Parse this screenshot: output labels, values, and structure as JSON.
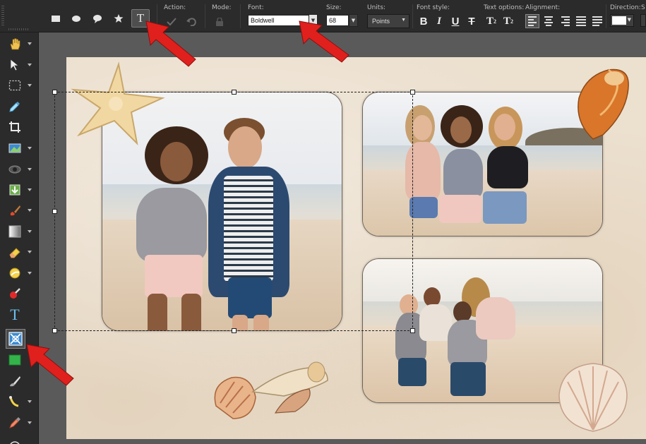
{
  "options_bar": {
    "labels": {
      "action": "Action:",
      "mode": "Mode:",
      "font": "Font:",
      "size": "Size:",
      "units": "Units:",
      "font_style": "Font style:",
      "text_options": "Text options:",
      "alignment": "Alignment:",
      "direction": "Direction:",
      "direction_cut": "S"
    },
    "shape_tools": [
      "rectangle-icon",
      "ellipse-icon",
      "speech-bubble-icon",
      "star-icon",
      "text-shape-icon"
    ],
    "selected_shape_tool": "text-shape-icon",
    "text_tool_glyph": "T",
    "font_value": "Boldwell",
    "size_value": "68",
    "units_value": "Points",
    "font_style_buttons": [
      {
        "name": "bold",
        "glyph": "B"
      },
      {
        "name": "italic",
        "glyph": "I"
      },
      {
        "name": "underline",
        "glyph": "U"
      },
      {
        "name": "strikethrough",
        "glyph": "T"
      }
    ],
    "text_options_buttons": [
      {
        "name": "superscript",
        "glyph": "T",
        "sub": "2"
      },
      {
        "name": "subscript",
        "glyph": "T",
        "sub": "2"
      }
    ],
    "alignment_buttons": [
      "align-left-icon",
      "align-center-icon",
      "align-right-icon",
      "justify-icon",
      "justify-all-icon"
    ],
    "selected_alignment": "align-left-icon",
    "direction_color": "#ffffff"
  },
  "toolbar": {
    "tools": [
      "pan-hand-icon",
      "pointer-icon",
      "marquee-selection-icon",
      "eyedropper-icon",
      "crop-icon",
      "straighten-icon",
      "eye-red-eye-icon",
      "import-icon",
      "paintbrush-icon",
      "gradient-icon",
      "eraser-icon",
      "dodge-icon",
      "paint-picker-icon",
      "text-icon",
      "picture-frame-icon",
      "rectangle-fill-icon",
      "clone-brush-icon",
      "smudge-icon",
      "color-dropper-icon",
      "more-icon"
    ],
    "text_tool_glyph": "T",
    "selected_tool": "picture-frame-icon"
  },
  "colors": {
    "chrome": "#2b2b2b",
    "workspace": "#5a5a5a",
    "paper": "#ece0cf",
    "annotation_arrow": "#e0201c",
    "green_tool": "#33b54a"
  }
}
